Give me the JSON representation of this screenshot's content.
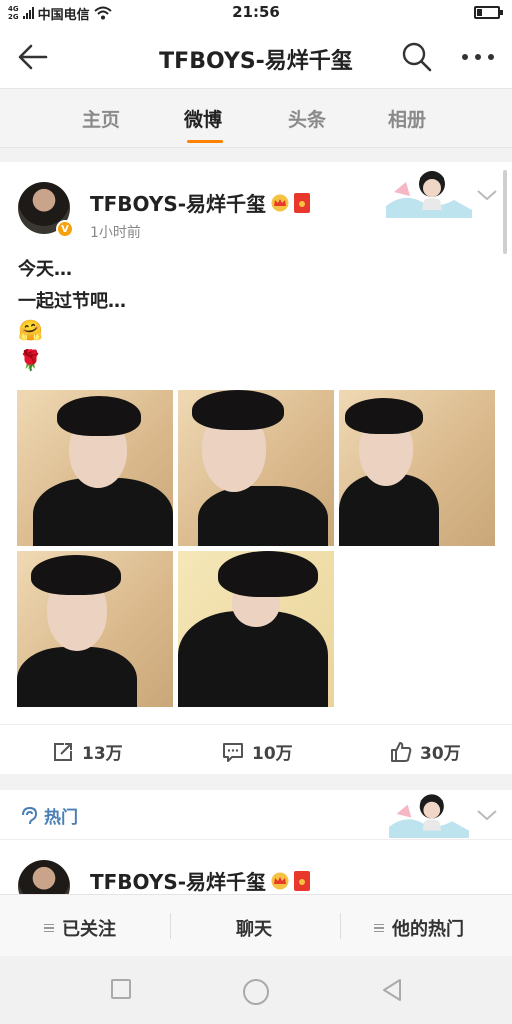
{
  "status_bar": {
    "network": "4G",
    "network_sub": "2G",
    "carrier": "中国电信",
    "time": "21:56",
    "battery_level": 0.25
  },
  "nav": {
    "title": "TFBOYS-易烊千玺",
    "back_icon": "arrow-left-icon",
    "search_icon": "search-icon",
    "more_icon": "more-dots-icon"
  },
  "tabs": [
    {
      "label": "主页",
      "active": false
    },
    {
      "label": "微博",
      "active": true
    },
    {
      "label": "头条",
      "active": false
    },
    {
      "label": "相册",
      "active": false
    }
  ],
  "accent_color": "#ff8200",
  "post": {
    "username": "TFBOYS-易烊千玺",
    "time": "1小时前",
    "lines": [
      "今天…",
      "一起过节吧…"
    ],
    "emoji1": "🤗",
    "emoji2": "🌹",
    "verified_badge": "V",
    "photo_count": 5
  },
  "actions": {
    "repost": "13万",
    "comment": "10万",
    "like": "30万"
  },
  "hot": {
    "label": "热门"
  },
  "post2": {
    "username": "TFBOYS-易烊千玺"
  },
  "bottom_bar": {
    "followed": "已关注",
    "chat": "聊天",
    "his_hot": "他的热门"
  }
}
